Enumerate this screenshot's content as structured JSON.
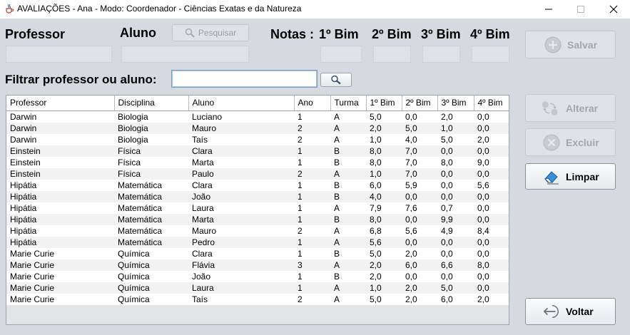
{
  "window": {
    "title": "AVALIAÇÕES - Ana - Modo: Coordenador - Ciências Exatas e da Natureza"
  },
  "form": {
    "professor_label": "Professor",
    "aluno_label": "Aluno",
    "search_button": "Pesquisar",
    "notas_label": "Notas :",
    "bim1_label": "1º Bim",
    "bim2_label": "2º Bim",
    "bim3_label": "3º Bim",
    "bim4_label": "4º Bim",
    "professor_value": "",
    "aluno_value": "",
    "bim1_value": "",
    "bim2_value": "",
    "bim3_value": "",
    "bim4_value": ""
  },
  "filter": {
    "label": "Filtrar professor ou aluno:",
    "value": ""
  },
  "buttons": {
    "salvar": "Salvar",
    "alterar": "Alterar",
    "excluir": "Excluir",
    "limpar": "Limpar",
    "voltar": "Voltar"
  },
  "table": {
    "columns": [
      "Professor",
      "Disciplina",
      "Aluno",
      "Ano",
      "Turma",
      "1º Bim",
      "2º Bim",
      "3º Bim",
      "4º Bim"
    ],
    "rows": [
      [
        "Darwin",
        "Biologia",
        "Luciano",
        "1",
        "A",
        "5,0",
        "0,0",
        "2,0",
        "0,0"
      ],
      [
        "Darwin",
        "Biologia",
        "Mauro",
        "2",
        "A",
        "2,0",
        "5,0",
        "1,0",
        "0,0"
      ],
      [
        "Darwin",
        "Biologia",
        "Taís",
        "2",
        "A",
        "1,0",
        "4,0",
        "5,0",
        "2,0"
      ],
      [
        "Einstein",
        "Física",
        "Clara",
        "1",
        "B",
        "8,0",
        "7,0",
        "0,0",
        "0,0"
      ],
      [
        "Einstein",
        "Física",
        "Marta",
        "1",
        "B",
        "8,0",
        "7,0",
        "8,0",
        "9,0"
      ],
      [
        "Einstein",
        "Física",
        "Paulo",
        "2",
        "A",
        "1,0",
        "7,0",
        "0,0",
        "0,0"
      ],
      [
        "Hipátia",
        "Matemática",
        "Clara",
        "1",
        "B",
        "6,0",
        "5,9",
        "0,0",
        "5,6"
      ],
      [
        "Hipátia",
        "Matemática",
        "João",
        "1",
        "B",
        "4,0",
        "0,0",
        "0,0",
        "0,0"
      ],
      [
        "Hipátia",
        "Matemática",
        "Laura",
        "1",
        "A",
        "7,9",
        "7,6",
        "0,7",
        "0,0"
      ],
      [
        "Hipátia",
        "Matemática",
        "Marta",
        "1",
        "B",
        "8,0",
        "0,0",
        "9,9",
        "0,0"
      ],
      [
        "Hipátia",
        "Matemática",
        "Mauro",
        "2",
        "A",
        "6,8",
        "5,6",
        "4,9",
        "8,4"
      ],
      [
        "Hipátia",
        "Matemática",
        "Pedro",
        "1",
        "A",
        "5,6",
        "0,0",
        "0,0",
        "0,0"
      ],
      [
        "Marie Curie",
        "Química",
        "Clara",
        "1",
        "B",
        "5,0",
        "2,0",
        "0,0",
        "0,0"
      ],
      [
        "Marie Curie",
        "Química",
        "Flávia",
        "3",
        "A",
        "2,0",
        "6,0",
        "6,6",
        "8,0"
      ],
      [
        "Marie Curie",
        "Química",
        "João",
        "1",
        "B",
        "2,0",
        "0,0",
        "0,0",
        "0,0"
      ],
      [
        "Marie Curie",
        "Química",
        "Laura",
        "1",
        "A",
        "1,0",
        "2,0",
        "5,0",
        "0,0"
      ],
      [
        "Marie Curie",
        "Química",
        "Taís",
        "2",
        "A",
        "5,0",
        "2,0",
        "6,0",
        "2,0"
      ]
    ]
  },
  "icons": {
    "app": "java-cup-icon",
    "search": "magnifier-icon",
    "salvar": "plus-circle-icon",
    "alterar": "swap-arrows-icon",
    "excluir": "x-circle-icon",
    "limpar": "eraser-icon",
    "voltar": "back-arrow-icon"
  }
}
